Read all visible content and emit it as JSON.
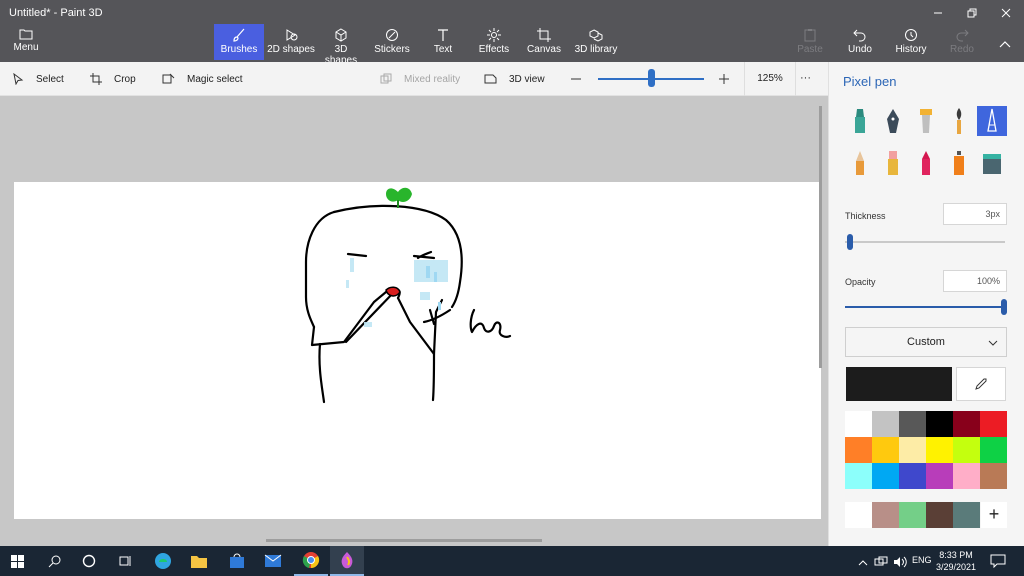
{
  "window": {
    "title": "Untitled* - Paint 3D",
    "controls": [
      "minimize-icon",
      "restore-icon",
      "close-icon"
    ]
  },
  "ribbon": {
    "menu_label": "Menu",
    "tools": [
      {
        "label": "Brushes",
        "icon": "brush-icon",
        "active": true
      },
      {
        "label": "2D shapes",
        "icon": "2d-shapes-icon"
      },
      {
        "label": "3D shapes",
        "icon": "3d-shapes-icon"
      },
      {
        "label": "Stickers",
        "icon": "stickers-icon"
      },
      {
        "label": "Text",
        "icon": "text-icon"
      },
      {
        "label": "Effects",
        "icon": "effects-icon"
      },
      {
        "label": "Canvas",
        "icon": "canvas-icon"
      },
      {
        "label": "3D library",
        "icon": "3d-library-icon"
      }
    ],
    "actions": [
      {
        "label": "Paste",
        "icon": "paste-icon",
        "disabled": true
      },
      {
        "label": "Undo",
        "icon": "undo-icon"
      },
      {
        "label": "History",
        "icon": "history-icon"
      },
      {
        "label": "Redo",
        "icon": "redo-icon",
        "disabled": true
      }
    ]
  },
  "toolbar": {
    "select_label": "Select",
    "crop_label": "Crop",
    "magic_select_label": "Magic select",
    "mixed_reality_label": "Mixed reality",
    "view_3d_label": "3D view",
    "zoom_value": "125%",
    "zoom_level_fraction": 0.5,
    "more": "···"
  },
  "panel": {
    "title": "Pixel pen",
    "brushes": [
      "marker-icon",
      "calligraphy-pen-icon",
      "oil-brush-icon",
      "watercolor-icon",
      "pixel-pen-icon",
      "pencil-icon",
      "eraser-icon",
      "crayon-icon",
      "spray-can-icon",
      "fill-icon"
    ],
    "selected_brush": "pixel-pen-icon",
    "thickness_label": "Thickness",
    "thickness_value": "3px",
    "thickness_fraction": 0.03,
    "opacity_label": "Opacity",
    "opacity_value": "100%",
    "opacity_fraction": 1.0,
    "color_mode": "Custom",
    "current_color": "#1c1c1c",
    "palette": [
      [
        "#ffffff",
        "#c3c3c3",
        "#585858",
        "#000000",
        "#88001b",
        "#ec1c24"
      ],
      [
        "#ff7f27",
        "#ffc90e",
        "#fdeca6",
        "#fff200",
        "#c4ff0e",
        "#0ed145"
      ],
      [
        "#8cfffb",
        "#00a8f3",
        "#3f48cc",
        "#b83dba",
        "#ffaec8",
        "#b97a56"
      ]
    ],
    "custom_colors": [
      "#ffffff",
      "#b88f88",
      "#74cf88",
      "#5a3f36",
      "#5a7b7a"
    ],
    "add_color": "+"
  },
  "canvas": {
    "ink_color": "#000000",
    "sprout_color": "#29b52c",
    "tear_color": "#9fd8f2",
    "mouth_color": "#d91e1e"
  },
  "taskbar": {
    "apps": [
      "start-icon",
      "search-icon",
      "cortana-icon",
      "task-view-icon",
      "edge-icon",
      "file-explorer-icon",
      "store-icon",
      "mail-icon",
      "chrome-icon",
      "paint-3d-icon"
    ],
    "ime": "ENG",
    "time": "8:33 PM",
    "date": "3/29/2021"
  }
}
